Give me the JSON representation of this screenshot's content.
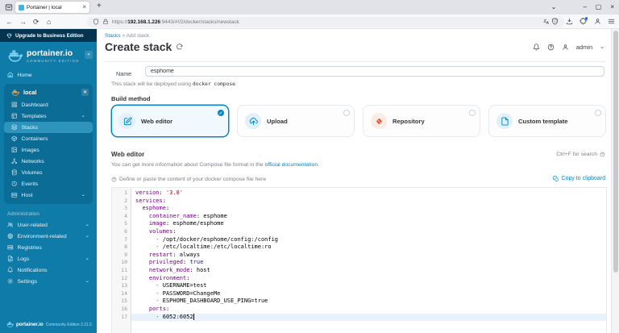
{
  "colors": {
    "accent": "#0086c9",
    "sidebar_bg": "#0e7ba8",
    "sidebar_panel": "#0b6c95",
    "sidebar_selected": "#2e94bc",
    "upgrade_bg": "#053450",
    "git_orange": "#f05133",
    "code_key": "#770088",
    "code_string": "#aa1111",
    "code_atom": "#221199",
    "code_meta": "#555555",
    "active_line": "#e8f2ff"
  },
  "browser": {
    "tab_title": "Portainer | local",
    "new_tab": "+",
    "url_protocol": "https://",
    "url_host": "192.168.1.226",
    "url_path": ":9443/#!/2/docker/stacks/newstack"
  },
  "sidebar": {
    "upgrade_label": "Upgrade to Business Edition",
    "brand": "portainer.io",
    "edition": "COMMUNITY EDITION",
    "home_label": "Home",
    "env_name": "local",
    "env_items": [
      {
        "label": "Dashboard",
        "icon": "grid-icon",
        "chevron": false,
        "selected": false
      },
      {
        "label": "Templates",
        "icon": "layout-icon",
        "chevron": true,
        "selected": false
      },
      {
        "label": "Stacks",
        "icon": "layers-icon",
        "chevron": false,
        "selected": true
      },
      {
        "label": "Containers",
        "icon": "box-icon",
        "chevron": false,
        "selected": false
      },
      {
        "label": "Images",
        "icon": "image-icon",
        "chevron": false,
        "selected": false
      },
      {
        "label": "Networks",
        "icon": "network-icon",
        "chevron": false,
        "selected": false
      },
      {
        "label": "Volumes",
        "icon": "database-icon",
        "chevron": false,
        "selected": false
      },
      {
        "label": "Events",
        "icon": "clock-icon",
        "chevron": false,
        "selected": false
      },
      {
        "label": "Host",
        "icon": "server-icon",
        "chevron": true,
        "selected": false
      }
    ],
    "admin_label": "Administration",
    "admin_items": [
      {
        "label": "User-related",
        "icon": "users-icon",
        "chevron": true
      },
      {
        "label": "Environment-related",
        "icon": "globe-icon",
        "chevron": true
      },
      {
        "label": "Registries",
        "icon": "hard-drive-icon",
        "chevron": false
      },
      {
        "label": "Logs",
        "icon": "file-text-icon",
        "chevron": true
      },
      {
        "label": "Notifications",
        "icon": "bell-icon",
        "chevron": false
      },
      {
        "label": "Settings",
        "icon": "gear-icon",
        "chevron": true
      }
    ],
    "footer_brand": "portainer.io",
    "footer_edition": "Community Edition",
    "footer_version": "2.21.5"
  },
  "header": {
    "breadcrumb_root": "Stacks",
    "breadcrumb_sep": ">",
    "breadcrumb_current": "Add stack",
    "title": "Create stack",
    "user": "admin"
  },
  "form": {
    "name_label": "Name",
    "name_value": "esphome",
    "deploy_prefix": "This stack will be deployed using",
    "deploy_code": "docker compose",
    "deploy_suffix": ".",
    "build_method_label": "Build method",
    "methods": [
      {
        "label": "Web editor",
        "icon": "edit-icon",
        "selected": true
      },
      {
        "label": "Upload",
        "icon": "upload-cloud-icon",
        "selected": false
      },
      {
        "label": "Repository",
        "icon": "git-icon",
        "selected": false
      },
      {
        "label": "Custom template",
        "icon": "file-icon",
        "selected": false
      }
    ]
  },
  "editor": {
    "title": "Web editor",
    "search_hint": "Ctrl+F for search",
    "info_prefix": "You can get more information about Compose file format in the ",
    "info_link": "official documentation",
    "info_suffix": ".",
    "placeholder_note": "Define or paste the content of your docker compose file here",
    "copy_label": "Copy to clipboard",
    "code_lines": [
      [
        [
          "k",
          "version"
        ],
        [
          "p",
          ": "
        ],
        [
          "s",
          "'3.8'"
        ]
      ],
      [
        [
          "k",
          "services"
        ],
        [
          "p",
          ":"
        ]
      ],
      [
        [
          "p",
          "  "
        ],
        [
          "k",
          "esphome"
        ],
        [
          "p",
          ":"
        ]
      ],
      [
        [
          "p",
          "    "
        ],
        [
          "k",
          "container_name"
        ],
        [
          "p",
          ": esphome"
        ]
      ],
      [
        [
          "p",
          "    "
        ],
        [
          "k",
          "image"
        ],
        [
          "p",
          ": esphome/esphome"
        ]
      ],
      [
        [
          "p",
          "    "
        ],
        [
          "k",
          "volumes"
        ],
        [
          "p",
          ":"
        ]
      ],
      [
        [
          "p",
          "      "
        ],
        [
          "m",
          "- "
        ],
        [
          "p",
          "/opt/docker/esphome/config:/config"
        ]
      ],
      [
        [
          "p",
          "      "
        ],
        [
          "m",
          "- "
        ],
        [
          "p",
          "/etc/localtime:/etc/localtime:ro"
        ]
      ],
      [
        [
          "p",
          "    "
        ],
        [
          "k",
          "restart"
        ],
        [
          "p",
          ": always"
        ]
      ],
      [
        [
          "p",
          "    "
        ],
        [
          "k",
          "privileged"
        ],
        [
          "p",
          ": "
        ],
        [
          "a",
          "true"
        ]
      ],
      [
        [
          "p",
          "    "
        ],
        [
          "k",
          "network_mode"
        ],
        [
          "p",
          ": host"
        ]
      ],
      [
        [
          "p",
          "    "
        ],
        [
          "k",
          "environment"
        ],
        [
          "p",
          ":"
        ]
      ],
      [
        [
          "p",
          "      "
        ],
        [
          "m",
          "- "
        ],
        [
          "p",
          "USERNAME=test"
        ]
      ],
      [
        [
          "p",
          "      "
        ],
        [
          "m",
          "- "
        ],
        [
          "p",
          "PASSWORD=ChangeMe"
        ]
      ],
      [
        [
          "p",
          "      "
        ],
        [
          "m",
          "- "
        ],
        [
          "p",
          "ESPHOME_DASHBOARD_USE_PING=true"
        ]
      ],
      [
        [
          "p",
          "    "
        ],
        [
          "k",
          "ports"
        ],
        [
          "p",
          ":"
        ]
      ],
      [
        [
          "p",
          "      "
        ],
        [
          "m",
          "- "
        ],
        [
          "p",
          "6052:6052"
        ]
      ]
    ]
  }
}
